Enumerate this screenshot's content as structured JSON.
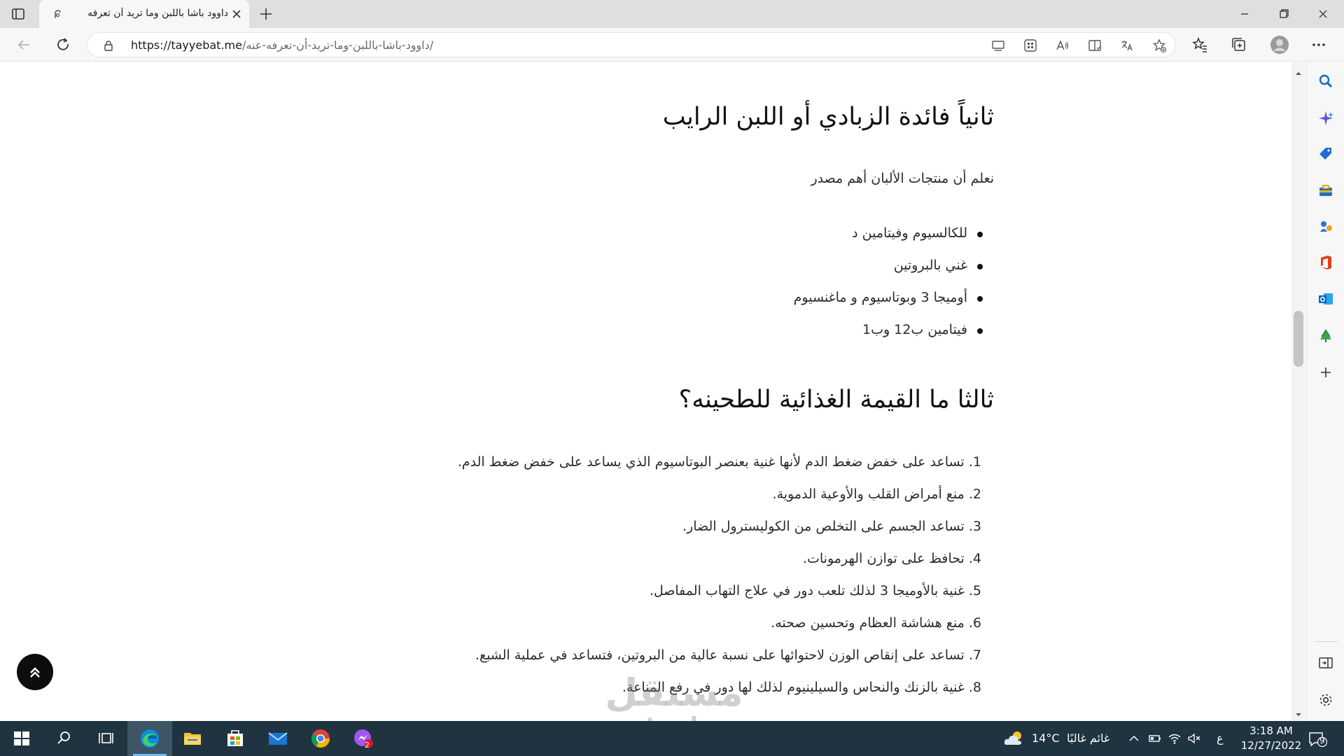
{
  "browser": {
    "tab_title": "داوود باشا باللبن وما تريد أن تعرفه",
    "url_host": "https://tayyebat.me",
    "url_path": "/داوود-باشا-باللبن-وما-تريد-أن-تعرفه-عنه/"
  },
  "article": {
    "section2_heading": "ثانياً فائدة الزبادي أو اللبن الرايب",
    "section2_intro": "نعلم أن منتجات الألبان أهم مصدر",
    "section2_bullets": [
      "للكالسيوم وفيتامين د",
      "غني بالبروتين",
      "أوميجا 3 وبوتاسيوم و ماغنسيوم",
      "فيتامين ب12 وب1"
    ],
    "section3_heading": "ثالثا ما القيمة الغذائية للطحينه؟",
    "section3_items": [
      "1. تساعد على خفض ضغط الدم لأنها غنية بعنصر البوتاسيوم الذي يساعد على خفض ضغط الدم.",
      "2. منع أمراض القلب والأوعية الدموية.",
      "3. تساعد الجسم على التخلص من الكوليسترول الضار.",
      "4. تحافظ على توازن الهرمونات.",
      "5. غنية بالأوميجا 3 لذلك تلعب دور في علاج التهاب المفاصل.",
      "6. منع هشاشة العظام وتحسين صحته.",
      "7. تساعد على إنقاص الوزن لاحتوائها على نسبة عالية من البروتين، فتساعد في عملية الشبع.",
      "8. غنية بالزنك والنحاس والسيلينيوم لذلك لها دور في رفع المناعة."
    ]
  },
  "watermark": {
    "arabic": "مستقل",
    "latin": "mostaql.com"
  },
  "taskbar": {
    "weather_temp": "14°C",
    "weather_text": "غائم غالبًا",
    "input_lang": "ع",
    "time": "3:18 AM",
    "date": "12/27/2022",
    "notification_count": "9",
    "app_badge": "2"
  },
  "icons": {
    "tab_actions": "tab-actions-icon",
    "favicon": "site-favicon-icon",
    "close": "close-icon",
    "new_tab": "plus-icon",
    "back": "back-arrow-icon",
    "refresh": "refresh-icon",
    "lock": "lock-icon",
    "sidebar": [
      "search-icon",
      "copilot-icon",
      "shopping-tag-icon",
      "tools-icon",
      "games-icon",
      "office-icon",
      "outlook-icon",
      "tree-icon",
      "add-icon",
      "split-screen-icon",
      "settings-icon"
    ]
  },
  "colors": {
    "taskbar_bg": "#1f3340",
    "edge_blue": "#0a6fc2",
    "scroll_to_top_bg": "#0d0d0d"
  }
}
